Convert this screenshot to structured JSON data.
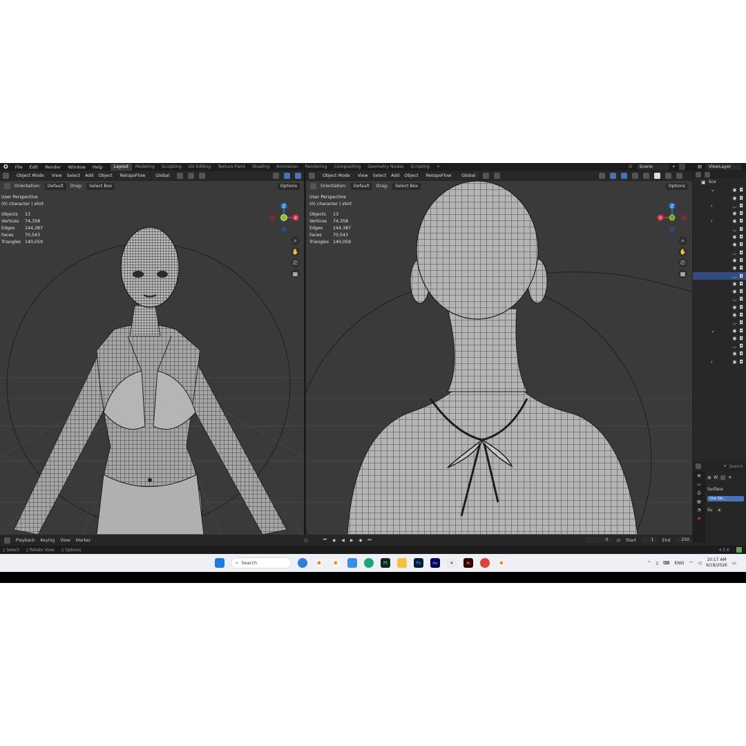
{
  "menu": [
    "File",
    "Edit",
    "Render",
    "Window",
    "Help"
  ],
  "workspaces": [
    "Layout",
    "Modeling",
    "Sculpting",
    "UV Editing",
    "Texture Paint",
    "Shading",
    "Animation",
    "Rendering",
    "Compositing",
    "Geometry Nodes",
    "Scripting"
  ],
  "active_workspace": "Layout",
  "scene": "Scene",
  "view_layer": "ViewLayer",
  "left_viewport": {
    "mode": "Object Mode",
    "menus": [
      "View",
      "Select",
      "Add",
      "Object"
    ],
    "addon": "RetopoFlow",
    "transform": "Global",
    "orientation_label": "Orientation:",
    "orientation_value": "Default",
    "drag_label": "Drag:",
    "drag_value": "Select Box",
    "options": "Options",
    "perspective": "User Perspective",
    "active": "(0) character | shirt",
    "stats": [
      {
        "label": "Objects",
        "value": "13"
      },
      {
        "label": "Vertices",
        "value": "74,358"
      },
      {
        "label": "Edges",
        "value": "144,387"
      },
      {
        "label": "Faces",
        "value": "70,543"
      },
      {
        "label": "Triangles",
        "value": "140,059"
      }
    ]
  },
  "right_viewport": {
    "mode": "Object Mode",
    "menus": [
      "View",
      "Select",
      "Add",
      "Object"
    ],
    "addon": "RetopoFlow",
    "transform": "Global",
    "orientation_label": "Orientation:",
    "orientation_value": "Default",
    "drag_label": "Drag:",
    "drag_value": "Select Box",
    "options": "Options",
    "perspective": "User Perspective",
    "active": "(0) character | shirt",
    "stats": [
      {
        "label": "Objects",
        "value": "13"
      },
      {
        "label": "Vertices",
        "value": "74,358"
      },
      {
        "label": "Edges",
        "value": "144,387"
      },
      {
        "label": "Faces",
        "value": "70,543"
      },
      {
        "label": "Triangles",
        "value": "140,059"
      }
    ]
  },
  "gizmo_axes": {
    "x": "X",
    "y": "Y",
    "z": "Z"
  },
  "timeline": {
    "menus": [
      "Playback",
      "Keying",
      "View",
      "Marker"
    ],
    "current_frame": "0",
    "start_label": "Start",
    "start_value": "1",
    "end_label": "End",
    "end_value": "250"
  },
  "statusbar": {
    "select": "Select",
    "rotate": "Rotate View",
    "options": "Options",
    "version": "4.5.6"
  },
  "outliner": {
    "header": "Sce"
  },
  "properties": {
    "search_placeholder": "Search",
    "world": "W",
    "surface": "Surface",
    "use_nodes": "Use No...",
    "su": "Su"
  },
  "taskbar": {
    "search": "Search",
    "lang": "ENG",
    "time": "10:17 AM",
    "date": "6/18/2026",
    "apps": [
      {
        "name": "photoshop",
        "label": "Ps",
        "color": "#001e36"
      },
      {
        "name": "after-effects",
        "label": "Ae",
        "color": "#00005b"
      },
      {
        "name": "illustrator",
        "label": "Ai",
        "color": "#330000"
      },
      {
        "name": "substance-painter",
        "label": "Pt",
        "color": "#0c2a1c"
      }
    ]
  },
  "colors": {
    "accent": "#4772b3",
    "x_axis": "#e0304a",
    "y_axis": "#8bbf2a",
    "z_axis": "#2e7bd6",
    "selection": "#334d80"
  }
}
